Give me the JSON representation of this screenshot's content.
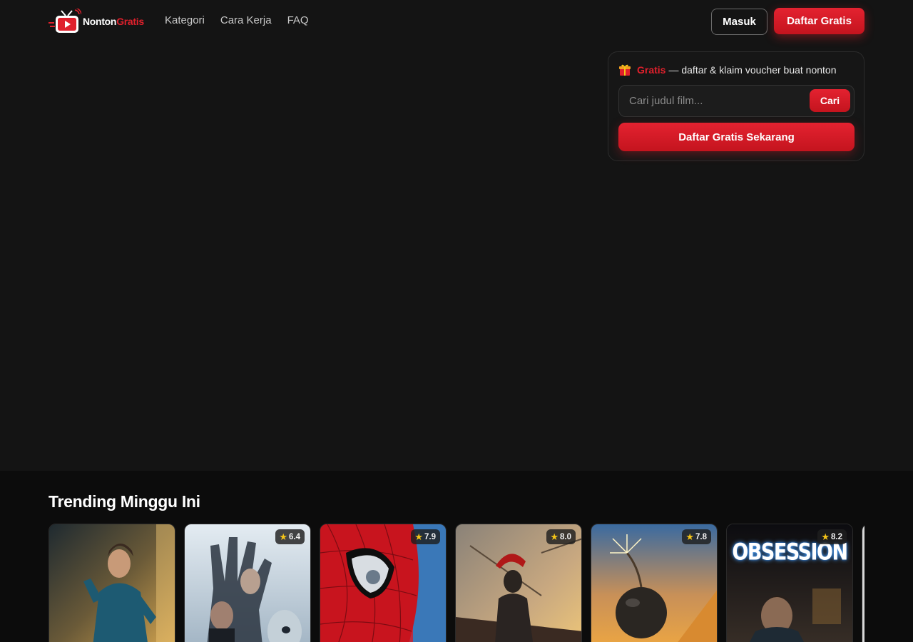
{
  "brand": {
    "name_part1": "Nonton",
    "name_part2": "Gratis",
    "accent_color": "#e0202c"
  },
  "nav": {
    "items": [
      {
        "label": "Kategori"
      },
      {
        "label": "Cara Kerja"
      },
      {
        "label": "FAQ"
      }
    ]
  },
  "auth": {
    "login_label": "Masuk",
    "register_label": "Daftar Gratis"
  },
  "promo": {
    "free_label": "Gratis",
    "text": "— daftar & klaim voucher buat nonton",
    "search_placeholder": "Cari judul film...",
    "search_button": "Cari",
    "cta_label": "Daftar Gratis Sekarang"
  },
  "trending": {
    "title": "Trending Minggu Ini",
    "cards": [
      {
        "rating": "",
        "icon": "poster-runner"
      },
      {
        "rating": "6.4",
        "icon": "poster-hand"
      },
      {
        "rating": "7.9",
        "icon": "poster-spiderman"
      },
      {
        "rating": "8.0",
        "icon": "poster-warrior"
      },
      {
        "rating": "7.8",
        "icon": "poster-bomb"
      },
      {
        "rating": "8.2",
        "icon": "poster-obsession",
        "poster_title": "OBSESSION"
      }
    ]
  },
  "colors": {
    "background": "#141414",
    "trending_background": "#0c0c0c",
    "primary": "#e0202c",
    "star": "#f5c518"
  }
}
